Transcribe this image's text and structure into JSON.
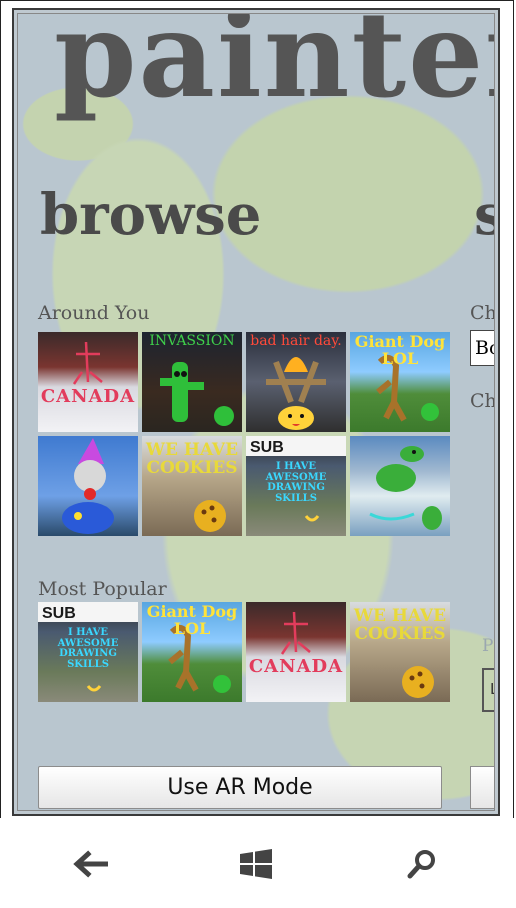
{
  "app": {
    "title": "painter",
    "pivot_headers": [
      "browse",
      "s"
    ]
  },
  "browse": {
    "around_you": {
      "label": "Around You",
      "tiles": [
        {
          "name": "canada",
          "caption": "CANADA"
        },
        {
          "name": "invasion",
          "caption": "INVASSION"
        },
        {
          "name": "bad-hair-day",
          "caption": "bad hair day."
        },
        {
          "name": "giant-dog",
          "caption": "Giant Dog LOL"
        },
        {
          "name": "clown",
          "caption": ""
        },
        {
          "name": "cookies",
          "caption": "WE HAVE COOKIES"
        },
        {
          "name": "subway",
          "caption": "I HAVE AWESOME DRAWING SKILLS"
        },
        {
          "name": "dino",
          "caption": ""
        }
      ]
    },
    "most_popular": {
      "label": "Most Popular",
      "tiles": [
        {
          "name": "subway",
          "caption": "I HAVE AWESOME DRAWING SKILLS"
        },
        {
          "name": "giant-dog",
          "caption": "Giant Dog LOL"
        },
        {
          "name": "canada",
          "caption": "CANADA"
        },
        {
          "name": "cookies",
          "caption": "WE HAVE COOKIES"
        }
      ]
    },
    "ar_button": "Use AR Mode"
  },
  "side_panel": {
    "label_1": "Cho",
    "field_value": "Bo",
    "label_2": "Cho",
    "faint_label": "Pr",
    "box_text": "L"
  },
  "nav": {
    "back_icon": "arrow-left-icon",
    "start_icon": "windows-logo-icon",
    "search_icon": "magnifier-icon"
  },
  "colors": {
    "title_grey": "#555555",
    "map_water": "#b9c6cf",
    "map_land": "#c7d6b5"
  }
}
